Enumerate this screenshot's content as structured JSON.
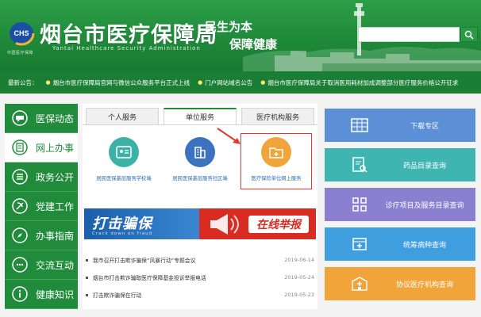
{
  "header": {
    "title": "烟台市医疗保障局",
    "subtitle": "Yantai Healthcare Security Administration",
    "logo_text": "中国医疗保障",
    "slogan_line1": "民生为本",
    "slogan_line2": "保障健康",
    "search": {
      "value": "",
      "placeholder": ""
    }
  },
  "notice": {
    "label": "最新公告：",
    "items": [
      "烟台市医疗保障局官网与微信公众服务平台正式上线",
      "门户网站域名公告",
      "烟台市医疗保障局关于取消医用耗材加成调整部分医疗服务价格公开征求"
    ]
  },
  "sidebar": {
    "items": [
      {
        "label": "医保动态",
        "icon": "speech-bubble-icon",
        "active": false
      },
      {
        "label": "网上办事",
        "icon": "document-icon",
        "active": true
      },
      {
        "label": "政务公开",
        "icon": "list-icon",
        "active": false
      },
      {
        "label": "党建工作",
        "icon": "party-emblem-icon",
        "active": false
      },
      {
        "label": "办事指南",
        "icon": "compass-icon",
        "active": false
      },
      {
        "label": "交流互动",
        "icon": "chat-icon",
        "active": false
      },
      {
        "label": "健康知识",
        "icon": "info-icon",
        "active": false
      }
    ]
  },
  "tabs": [
    "个人服务",
    "单位服务",
    "医疗机构服务"
  ],
  "active_tab": "单位服务",
  "services": [
    {
      "label": "居民医保基层服务学校端",
      "color": "#3cb2a6"
    },
    {
      "label": "居民医保基层服务社区端",
      "color": "#3c72c0"
    },
    {
      "label": "医疗保险单位网上服务",
      "color": "#f0a43a"
    }
  ],
  "banner": {
    "title": "打击骗保",
    "subtitle": "Crack down on fraud",
    "call": "在线举报"
  },
  "news": [
    {
      "title": "我市召开打击欺诈骗保“风暴行动”专题会议",
      "date": "2019-06-14"
    },
    {
      "title": "烟台市打击欺诈骗取医疗保障基金投诉举报电话",
      "date": "2019-05-24"
    },
    {
      "title": "打击欺诈骗保在行动",
      "date": "2019-05-23"
    }
  ],
  "quick_links": [
    {
      "label": "下载专区",
      "color": "#5b8fd6",
      "icon": "grid-icon"
    },
    {
      "label": "药品目录查询",
      "color": "#3fb5b1",
      "icon": "clipboard-search-icon"
    },
    {
      "label": "诊疗项目及服务目录查询",
      "color": "#8b7fcf",
      "icon": "apps-grid-icon"
    },
    {
      "label": "统筹病种查询",
      "color": "#3f9fde",
      "icon": "add-folder-icon"
    },
    {
      "label": "协议医疗机构查询",
      "color": "#f0a43a",
      "icon": "hospital-icon"
    }
  ],
  "colors": {
    "brand_green": "#1f8b3b",
    "notice_green": "#1b7e35",
    "highlight_red": "#e33a2f"
  }
}
